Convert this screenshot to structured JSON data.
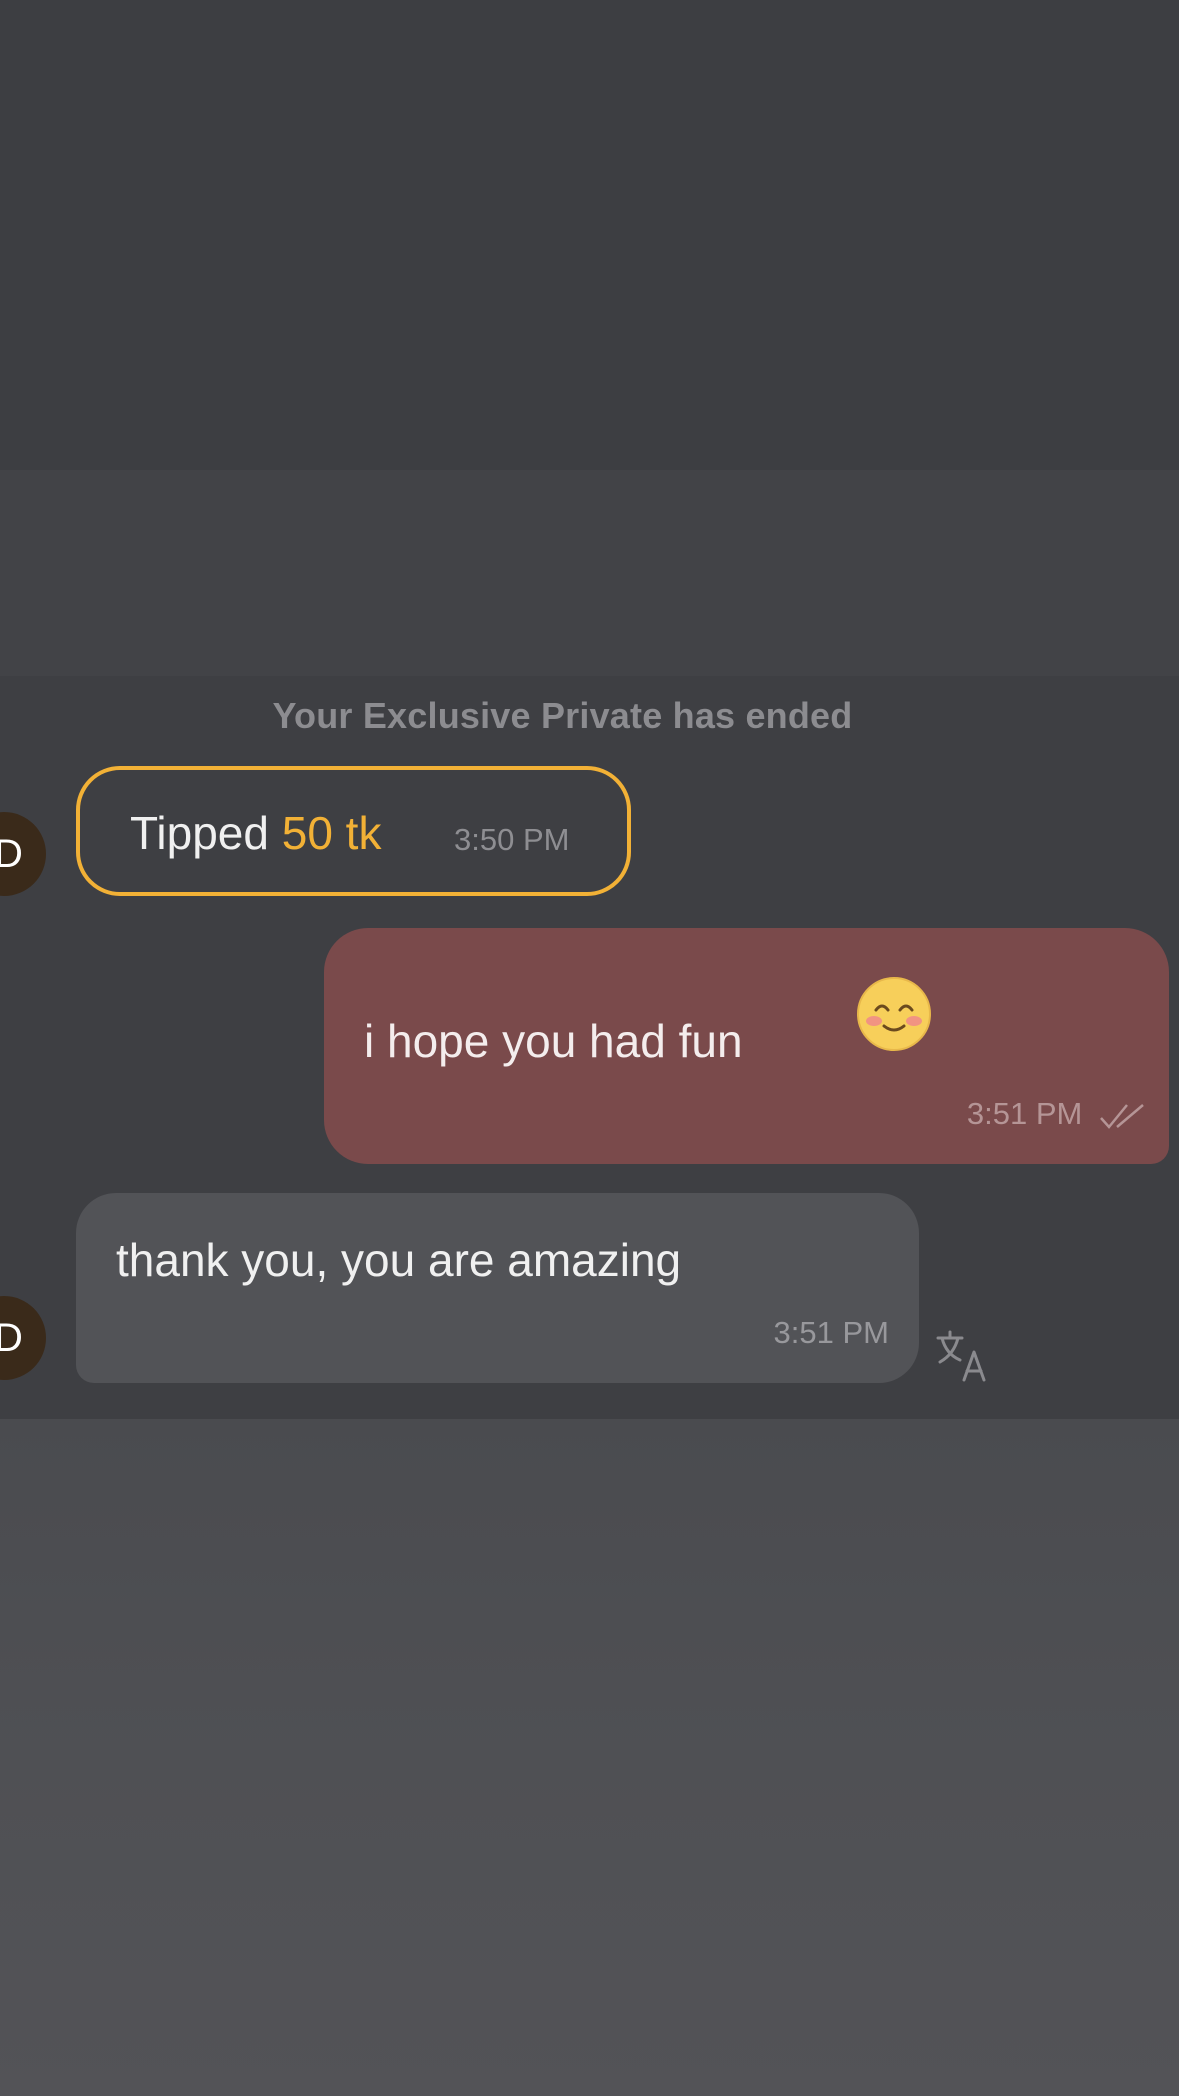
{
  "chat": {
    "system_notice": "Your Exclusive Private has ended",
    "avatar_letter": "D",
    "tip": {
      "label": "Tipped",
      "amount": "50 tk",
      "time": "3:50 PM"
    },
    "sent_message": {
      "text": "i hope you had fun",
      "emoji": "smiling-face-with-blush-emoji",
      "time": "3:51 PM",
      "status_icon": "double-check-icon"
    },
    "received_message": {
      "text": "thank you, you are amazing",
      "time": "3:51 PM",
      "action_icon": "translate-icon"
    }
  },
  "colors": {
    "tip_accent": "#f2b136",
    "sent_bubble": "#7a4a4b",
    "received_bubble": "#525357",
    "panel": "#3e3f43"
  }
}
